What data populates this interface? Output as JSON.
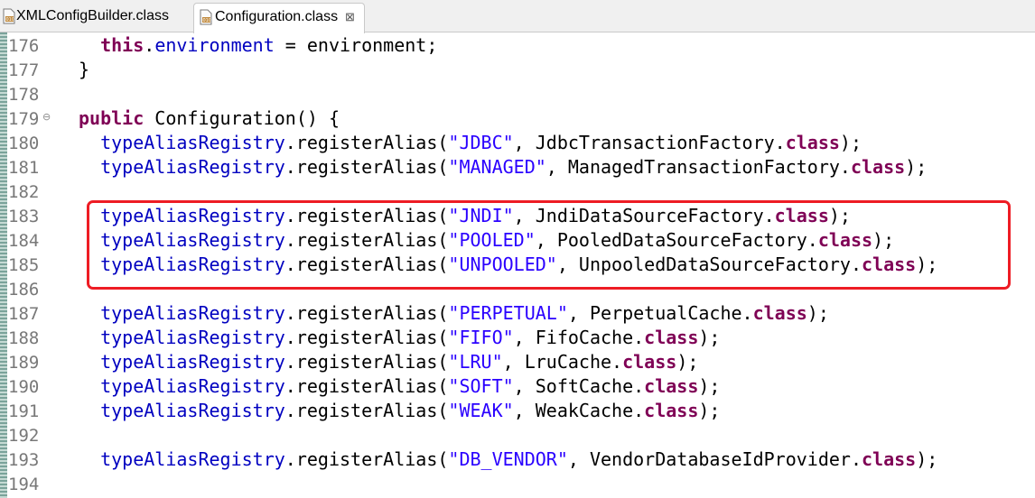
{
  "tabs": [
    {
      "label": "XMLConfigBuilder.class",
      "active": false,
      "icon": "class-file-icon"
    },
    {
      "label": "Configuration.class",
      "active": true,
      "icon": "class-file-icon",
      "close": "⊠"
    }
  ],
  "editor": {
    "fold_marker": "⊖",
    "lines": [
      {
        "num": "176",
        "tokens": [
          [
            "",
            "  "
          ],
          [
            "kw",
            "this"
          ],
          [
            "plain",
            "."
          ],
          [
            "fld",
            "environment"
          ],
          [
            "plain",
            " = environment;"
          ]
        ]
      },
      {
        "num": "177",
        "tokens": [
          [
            "plain",
            "}"
          ]
        ]
      },
      {
        "num": "178",
        "tokens": []
      },
      {
        "num": "179",
        "fold": true,
        "tokens": [
          [
            "kw",
            "public"
          ],
          [
            "plain",
            " Configuration() {"
          ]
        ]
      },
      {
        "num": "180",
        "tokens": [
          [
            "",
            "  "
          ],
          [
            "fld",
            "typeAliasRegistry"
          ],
          [
            "plain",
            ".registerAlias("
          ],
          [
            "str",
            "\"JDBC\""
          ],
          [
            "plain",
            ", JdbcTransactionFactory."
          ],
          [
            "kw",
            "class"
          ],
          [
            "plain",
            ");"
          ]
        ]
      },
      {
        "num": "181",
        "tokens": [
          [
            "",
            "  "
          ],
          [
            "fld",
            "typeAliasRegistry"
          ],
          [
            "plain",
            ".registerAlias("
          ],
          [
            "str",
            "\"MANAGED\""
          ],
          [
            "plain",
            ", ManagedTransactionFactory."
          ],
          [
            "kw",
            "class"
          ],
          [
            "plain",
            ");"
          ]
        ]
      },
      {
        "num": "182",
        "tokens": []
      },
      {
        "num": "183",
        "tokens": [
          [
            "",
            "  "
          ],
          [
            "fld",
            "typeAliasRegistry"
          ],
          [
            "plain",
            ".registerAlias("
          ],
          [
            "str",
            "\"JNDI\""
          ],
          [
            "plain",
            ", JndiDataSourceFactory."
          ],
          [
            "kw",
            "class"
          ],
          [
            "plain",
            ");"
          ]
        ]
      },
      {
        "num": "184",
        "tokens": [
          [
            "",
            "  "
          ],
          [
            "fld",
            "typeAliasRegistry"
          ],
          [
            "plain",
            ".registerAlias("
          ],
          [
            "str",
            "\"POOLED\""
          ],
          [
            "plain",
            ", PooledDataSourceFactory."
          ],
          [
            "kw",
            "class"
          ],
          [
            "plain",
            ");"
          ]
        ]
      },
      {
        "num": "185",
        "tokens": [
          [
            "",
            "  "
          ],
          [
            "fld",
            "typeAliasRegistry"
          ],
          [
            "plain",
            ".registerAlias("
          ],
          [
            "str",
            "\"UNPOOLED\""
          ],
          [
            "plain",
            ", UnpooledDataSourceFactory."
          ],
          [
            "kw",
            "class"
          ],
          [
            "plain",
            ");"
          ]
        ]
      },
      {
        "num": "186",
        "tokens": []
      },
      {
        "num": "187",
        "tokens": [
          [
            "",
            "  "
          ],
          [
            "fld",
            "typeAliasRegistry"
          ],
          [
            "plain",
            ".registerAlias("
          ],
          [
            "str",
            "\"PERPETUAL\""
          ],
          [
            "plain",
            ", PerpetualCache."
          ],
          [
            "kw",
            "class"
          ],
          [
            "plain",
            ");"
          ]
        ]
      },
      {
        "num": "188",
        "tokens": [
          [
            "",
            "  "
          ],
          [
            "fld",
            "typeAliasRegistry"
          ],
          [
            "plain",
            ".registerAlias("
          ],
          [
            "str",
            "\"FIFO\""
          ],
          [
            "plain",
            ", FifoCache."
          ],
          [
            "kw",
            "class"
          ],
          [
            "plain",
            ");"
          ]
        ]
      },
      {
        "num": "189",
        "tokens": [
          [
            "",
            "  "
          ],
          [
            "fld",
            "typeAliasRegistry"
          ],
          [
            "plain",
            ".registerAlias("
          ],
          [
            "str",
            "\"LRU\""
          ],
          [
            "plain",
            ", LruCache."
          ],
          [
            "kw",
            "class"
          ],
          [
            "plain",
            ");"
          ]
        ]
      },
      {
        "num": "190",
        "tokens": [
          [
            "",
            "  "
          ],
          [
            "fld",
            "typeAliasRegistry"
          ],
          [
            "plain",
            ".registerAlias("
          ],
          [
            "str",
            "\"SOFT\""
          ],
          [
            "plain",
            ", SoftCache."
          ],
          [
            "kw",
            "class"
          ],
          [
            "plain",
            ");"
          ]
        ]
      },
      {
        "num": "191",
        "tokens": [
          [
            "",
            "  "
          ],
          [
            "fld",
            "typeAliasRegistry"
          ],
          [
            "plain",
            ".registerAlias("
          ],
          [
            "str",
            "\"WEAK\""
          ],
          [
            "plain",
            ", WeakCache."
          ],
          [
            "kw",
            "class"
          ],
          [
            "plain",
            ");"
          ]
        ]
      },
      {
        "num": "192",
        "tokens": []
      },
      {
        "num": "193",
        "tokens": [
          [
            "",
            "  "
          ],
          [
            "fld",
            "typeAliasRegistry"
          ],
          [
            "plain",
            ".registerAlias("
          ],
          [
            "str",
            "\"DB_VENDOR\""
          ],
          [
            "plain",
            ", VendorDatabaseIdProvider."
          ],
          [
            "kw",
            "class"
          ],
          [
            "plain",
            ");"
          ]
        ]
      },
      {
        "num": "194",
        "tokens": []
      }
    ]
  },
  "colors": {
    "keyword": "#7f0055",
    "field": "#0000c0",
    "string": "#2a00ff",
    "highlight_box": "#ee1c24"
  }
}
